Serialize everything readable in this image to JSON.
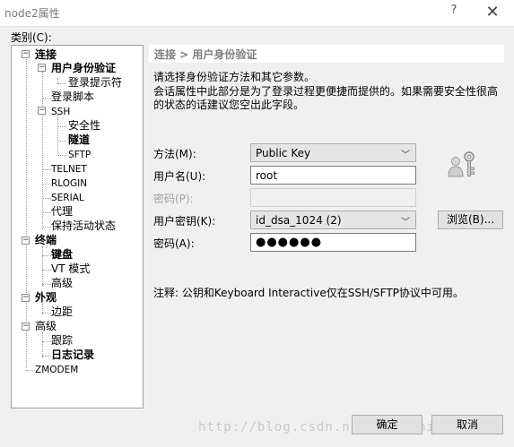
{
  "window": {
    "title": "node2属性",
    "help_glyph": "?",
    "close_glyph": "✕"
  },
  "category_label": "类别(C):",
  "tree": {
    "nodes": [
      {
        "label": "连接"
      },
      {
        "label": "用户身份验证"
      },
      {
        "label": "登录提示符"
      },
      {
        "label": "登录脚本"
      },
      {
        "label": "SSH"
      },
      {
        "label": "安全性"
      },
      {
        "label": "隧道"
      },
      {
        "label": "SFTP"
      },
      {
        "label": "TELNET"
      },
      {
        "label": "RLOGIN"
      },
      {
        "label": "SERIAL"
      },
      {
        "label": "代理"
      },
      {
        "label": "保持活动状态"
      },
      {
        "label": "终端"
      },
      {
        "label": "键盘"
      },
      {
        "label": "VT 模式"
      },
      {
        "label": "高级"
      },
      {
        "label": "外观"
      },
      {
        "label": "边距"
      },
      {
        "label": "高级"
      },
      {
        "label": "跟踪"
      },
      {
        "label": "日志记录"
      },
      {
        "label": "ZMODEM"
      }
    ],
    "expanded_glyph": "−"
  },
  "panel": {
    "header": "连接 > 用户身份验证",
    "desc1": "请选择身份验证方法和其它参数。",
    "desc2": "会话属性中此部分是为了登录过程更便捷而提供的。如果需要安全性很高的状态的话建议您空出此字段。",
    "method_label": "方法(M):",
    "method_value": "Public Key",
    "username_label": "用户名(U):",
    "username_value": "root",
    "password_label": "密码(P):",
    "password_value": "",
    "userkey_label": "用户密钥(K):",
    "userkey_value": "id_dsa_1024 (2)",
    "browse_label": "浏览(B)...",
    "passphrase_label": "密码(A):",
    "passphrase_value": "●●●●●●",
    "note": "注释: 公钥和Keyboard Interactive仅在SSH/SFTP协议中可用。",
    "chevron_glyph": "﹀"
  },
  "buttons": {
    "ok": "确定",
    "cancel": "取消"
  },
  "watermark": "http://blog.csdn.net/lightningyyws"
}
